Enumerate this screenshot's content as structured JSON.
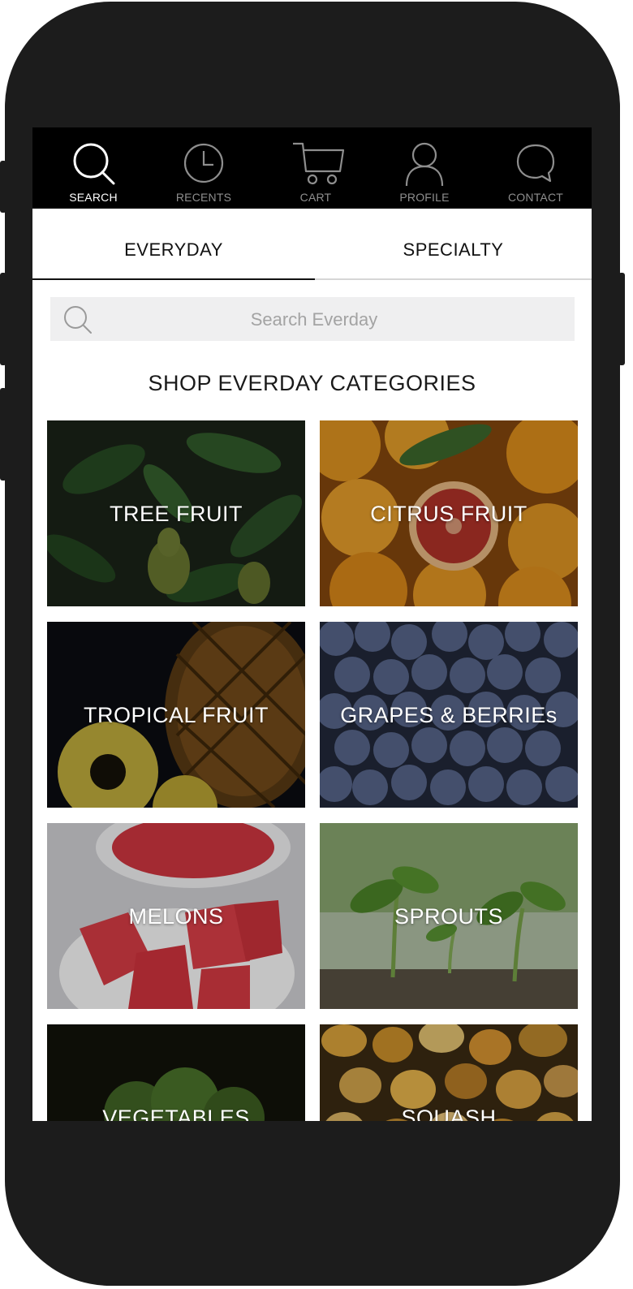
{
  "nav": {
    "items": [
      {
        "label": "SEARCH",
        "icon": "search-icon",
        "active": true
      },
      {
        "label": "RECENTS",
        "icon": "clock-icon",
        "active": false
      },
      {
        "label": "CART",
        "icon": "cart-icon",
        "active": false
      },
      {
        "label": "PROFILE",
        "icon": "user-icon",
        "active": false
      },
      {
        "label": "CONTACT",
        "icon": "chat-bubble-icon",
        "active": false
      }
    ]
  },
  "tabs": {
    "everyday": "EVERYDAY",
    "specialty": "SPECIALTY",
    "selected": "EVERYDAY"
  },
  "search": {
    "placeholder": "Search Everday",
    "value": ""
  },
  "section_title": "SHOP EVERDAY CATEGORIES",
  "categories": [
    {
      "label": "TREE FRUIT",
      "image": "pears-on-branch"
    },
    {
      "label": "CITRUS FRUIT",
      "image": "oranges-and-blood-orange"
    },
    {
      "label": "TROPICAL FRUIT",
      "image": "pineapple"
    },
    {
      "label": "GRAPES & BERRIEs",
      "image": "blueberries"
    },
    {
      "label": "MELONS",
      "image": "watermelon-cubes"
    },
    {
      "label": "SPROUTS",
      "image": "seedlings"
    },
    {
      "label": "VEGETABLES",
      "image": "brussels-sprouts"
    },
    {
      "label": "SQUASH",
      "image": "gourds"
    }
  ],
  "colors": {
    "device": "#1c1c1c",
    "nav_bg": "#000000",
    "nav_active": "#ffffff",
    "nav_inactive": "#8e8e8e",
    "search_bg": "#efeff0"
  }
}
